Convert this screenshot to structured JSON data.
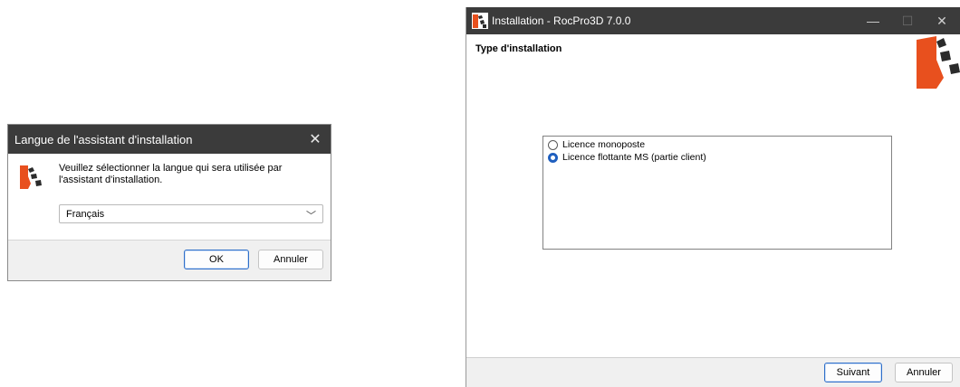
{
  "language_dialog": {
    "title": "Langue de l'assistant d'installation",
    "close_glyph": "✕",
    "prompt": "Veuillez sélectionner la langue qui sera utilisée par l'assistant d'installation.",
    "selected_language": "Français",
    "dropdown_glyph": "﹀",
    "ok_label": "OK",
    "cancel_label": "Annuler",
    "logo_icon": "rocscience-logo-icon"
  },
  "installer": {
    "title": "Installation - RocPro3D 7.0.0",
    "page_title": "Type d'installation",
    "window_controls": {
      "minimize": "—",
      "maximize": "☐",
      "close": "✕"
    },
    "options": [
      {
        "label": "Licence monoposte",
        "checked": false
      },
      {
        "label": "Licence flottante MS (partie client)",
        "checked": true
      }
    ],
    "next_label": "Suivant",
    "cancel_label": "Annuler",
    "colors": {
      "brand": "#e8501e",
      "radio_accent": "#1f5fbf",
      "titlebar": "#3b3b3b"
    }
  }
}
